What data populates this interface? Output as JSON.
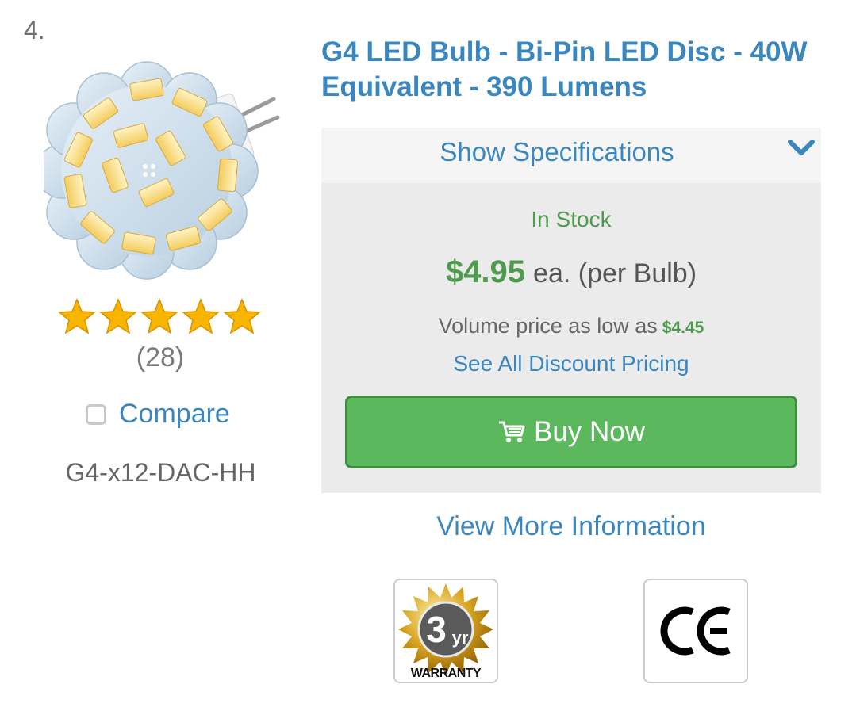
{
  "listing": {
    "index": "4."
  },
  "product": {
    "title": "G4 LED Bulb - Bi-Pin LED Disc - 40W Equivalent - 390 Lumens",
    "rating_stars": 5,
    "review_count": "(28)",
    "compare_label": "Compare",
    "sku": "G4-x12-DAC-HH"
  },
  "specs": {
    "toggle_label": "Show Specifications"
  },
  "pricing": {
    "stock_status": "In Stock",
    "price": "$4.95",
    "unit": "ea. (per Bulb)",
    "volume_text": "Volume price as low as",
    "volume_price": "$4.45",
    "discount_link": "See All Discount Pricing",
    "buy_label": "Buy Now"
  },
  "more_info_link": "View More Information",
  "badges": {
    "warranty": {
      "number": "3",
      "suffix": "yr",
      "label": "WARRANTY"
    },
    "ce": {
      "label": "CE"
    }
  },
  "colors": {
    "link_blue": "#3a86be",
    "stock_green": "#4f9a4f",
    "button_green": "#5cb85c",
    "star_gold": "#f7b500"
  },
  "icons": {
    "chevron": "chevron-down-icon",
    "cart": "cart-icon",
    "star": "star-icon"
  }
}
